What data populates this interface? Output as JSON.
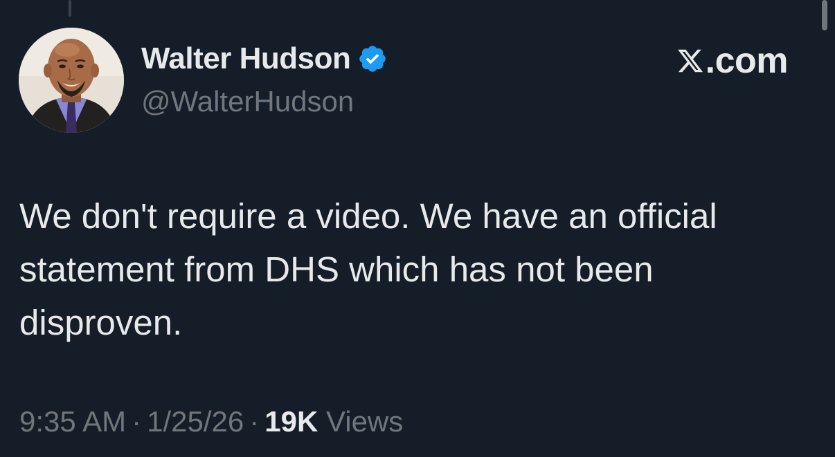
{
  "tweet": {
    "author": {
      "display_name": "Walter Hudson",
      "handle": "@WalterHudson",
      "verified": true,
      "avatar": "avatar"
    },
    "brand": {
      "text": "X.com",
      "icon": "x-logo-icon"
    },
    "text_lines": [
      "We don't require a video. We have an official",
      "statement from DHS which has not been",
      "disproven."
    ],
    "meta": {
      "time": "9:35 AM",
      "separator": "·",
      "date": "1/25/26",
      "views_count": "19K",
      "views_label": "Views"
    }
  },
  "colors": {
    "background": "#151d28",
    "text_primary": "#e7e9ea",
    "text_secondary": "#71767b",
    "verified_badge": "#1d9bf0"
  }
}
